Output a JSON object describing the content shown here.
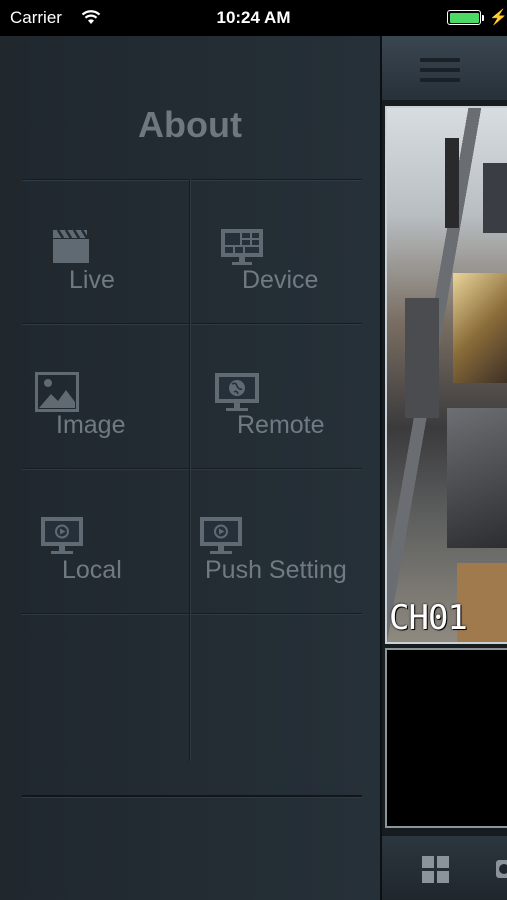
{
  "status_bar": {
    "carrier": "Carrier",
    "time": "10:24 AM"
  },
  "menu": {
    "title": "About",
    "items": [
      {
        "label": "Live",
        "icon": "clapperboard-icon"
      },
      {
        "label": "Device",
        "icon": "device-grid-icon"
      },
      {
        "label": "Image",
        "icon": "image-icon"
      },
      {
        "label": "Remote",
        "icon": "remote-globe-monitor-icon"
      },
      {
        "label": "Local",
        "icon": "local-play-monitor-icon"
      },
      {
        "label": "Push Setting",
        "icon": "push-play-monitor-icon"
      }
    ]
  },
  "video": {
    "channel_label": "CH01"
  },
  "colors": {
    "panel_bg": "#222a30",
    "text": "#707a82",
    "battery": "#4cd964"
  }
}
